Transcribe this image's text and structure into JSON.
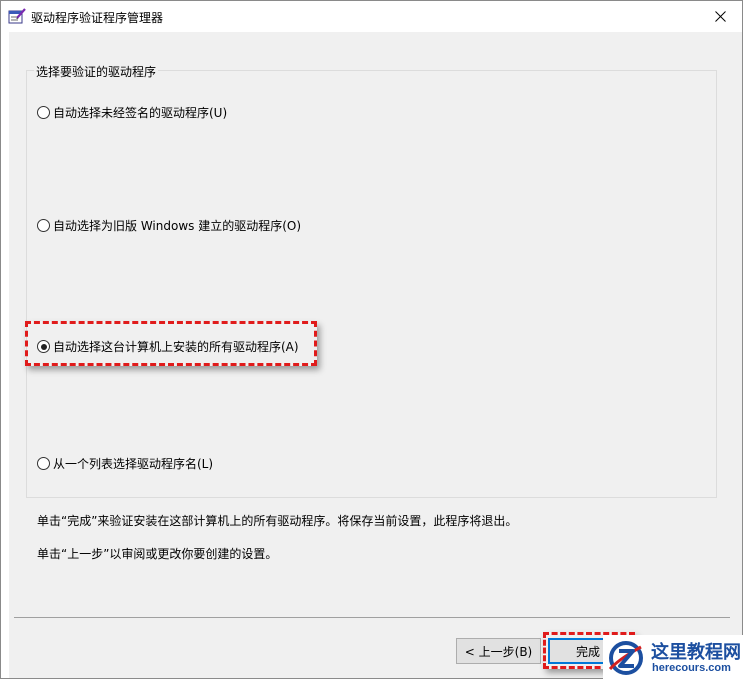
{
  "window": {
    "title": "驱动程序验证程序管理器",
    "icon": "verifier-checklist-icon"
  },
  "group": {
    "legend": "选择要验证的驱动程序",
    "options": [
      {
        "label": "自动选择未经签名的驱动程序(U)",
        "checked": false
      },
      {
        "label": "自动选择为旧版 Windows 建立的驱动程序(O)",
        "checked": false
      },
      {
        "label": "自动选择这台计算机上安装的所有驱动程序(A)",
        "checked": true
      },
      {
        "label": "从一个列表选择驱动程序名(L)",
        "checked": false
      }
    ]
  },
  "info": {
    "line1": "单击“完成”来验证安装在这部计算机上的所有驱动程序。将保存当前设置，此程序将退出。",
    "line2": "单击“上一步”以审阅或更改你要创建的设置。"
  },
  "buttons": {
    "back": "< 上一步(B)",
    "finish": "完成"
  },
  "watermark": {
    "title": "这里教程网",
    "url": "herecours.com"
  },
  "colors": {
    "highlight": "#e01b1b",
    "accent": "#0078d7",
    "watermark": "#1c4fa0"
  }
}
